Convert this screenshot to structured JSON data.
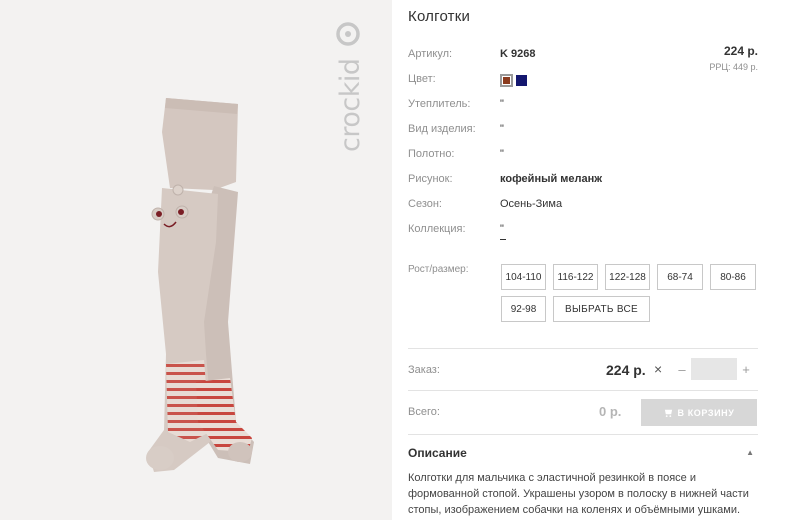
{
  "brand": {
    "logo_text": "crockid"
  },
  "product": {
    "title": "Колготки",
    "price": "224 р.",
    "rrp": "РРЦ: 449 р."
  },
  "specs": [
    {
      "label": "Артикул:",
      "value": "K 9268",
      "bold": true
    },
    {
      "label": "Цвет:",
      "value": ""
    },
    {
      "label": "Утеплитель:",
      "value": "\""
    },
    {
      "label": "Вид изделия:",
      "value": "\""
    },
    {
      "label": "Полотно:",
      "value": "\""
    },
    {
      "label": "Рисунок:",
      "value": "кофейный меланж",
      "bold": true
    },
    {
      "label": "Сезон:",
      "value": "Осень-Зима"
    },
    {
      "label": "Коллекция:",
      "value": "\""
    }
  ],
  "colors": [
    {
      "name": "brown",
      "hex": "#8b3b1e",
      "selected": true
    },
    {
      "name": "navy",
      "hex": "#14176f",
      "selected": false
    }
  ],
  "sizes": {
    "label": "Рост/размер:",
    "options": [
      "104-110",
      "116-122",
      "122-128",
      "68-74",
      "80-86",
      "92-98"
    ],
    "select_all": "ВЫБРАТЬ ВСЕ"
  },
  "order": {
    "label": "Заказ:",
    "price": "224 р.",
    "times_icon": "×",
    "minus": "–",
    "plus": "+",
    "quantity": ""
  },
  "total": {
    "label": "Всего:",
    "value": "0 р.",
    "cart_button": "В КОРЗИНУ"
  },
  "description": {
    "title": "Описание",
    "collapse_icon": "▲",
    "text": "Колготки для мальчика с эластичной резинкой в поясе и формованной стопой. Украшены узором в полоску в нижней части стопы, изображением собачки на коленях и объёмными ушками."
  },
  "theme": {
    "label_color": "#8f8f8f",
    "text_color": "#333333",
    "image_bg": "#f3f2f1",
    "tights_color": "#d4c7c0",
    "stripe_color": "#c8463e",
    "button_disabled": "#d7d7d7"
  }
}
